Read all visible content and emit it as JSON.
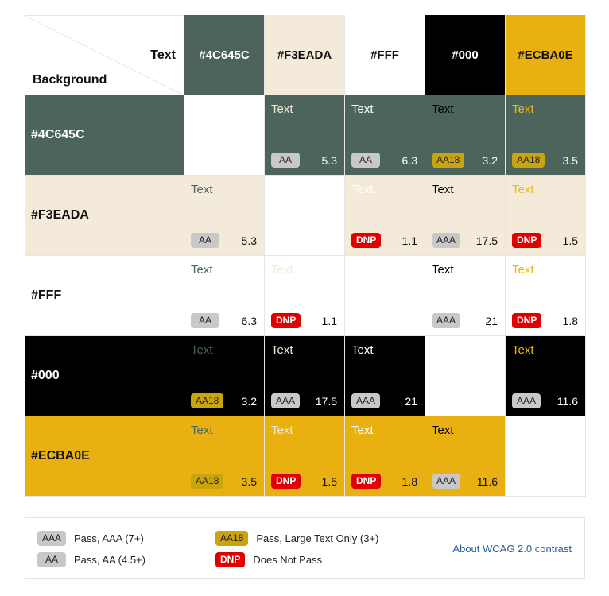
{
  "corner": {
    "text_label": "Text",
    "background_label": "Background"
  },
  "columns": [
    {
      "label": "#4C645C",
      "bg": "#4C645C",
      "fg": "#ffffff"
    },
    {
      "label": "#F3EADA",
      "bg": "#F3EADA",
      "fg": "#111111"
    },
    {
      "label": "#FFF",
      "bg": "#FFFFFF",
      "fg": "#111111"
    },
    {
      "label": "#000",
      "bg": "#000000",
      "fg": "#ffffff"
    },
    {
      "label": "#ECBA0E",
      "bg": "#E8B010",
      "fg": "#111111"
    }
  ],
  "rows": [
    {
      "label": "#4C645C",
      "bg": "#4C645C",
      "fg": "#ffffff",
      "cells": [
        null,
        {
          "text": "Text",
          "color": "#F3EADA",
          "badge": "AA",
          "ratio": "5.3"
        },
        {
          "text": "Text",
          "color": "#FFFFFF",
          "badge": "AA",
          "ratio": "6.3"
        },
        {
          "text": "Text",
          "color": "#000000",
          "badge": "AA18",
          "ratio": "3.2"
        },
        {
          "text": "Text",
          "color": "#ECBA0E",
          "badge": "AA18",
          "ratio": "3.5"
        }
      ]
    },
    {
      "label": "#F3EADA",
      "bg": "#F3EADA",
      "fg": "#111111",
      "cells": [
        {
          "text": "Text",
          "color": "#4C645C",
          "badge": "AA",
          "ratio": "5.3"
        },
        null,
        {
          "text": "Text",
          "color": "#FFFFFF",
          "badge": "DNP",
          "ratio": "1.1"
        },
        {
          "text": "Text",
          "color": "#000000",
          "badge": "AAA",
          "ratio": "17.5"
        },
        {
          "text": "Text",
          "color": "#ECBA0E",
          "badge": "DNP",
          "ratio": "1.5"
        }
      ]
    },
    {
      "label": "#FFF",
      "bg": "#FFFFFF",
      "fg": "#111111",
      "cells": [
        {
          "text": "Text",
          "color": "#4C645C",
          "badge": "AA",
          "ratio": "6.3"
        },
        {
          "text": "Text",
          "color": "#F3EADA",
          "badge": "DNP",
          "ratio": "1.1"
        },
        null,
        {
          "text": "Text",
          "color": "#000000",
          "badge": "AAA",
          "ratio": "21"
        },
        {
          "text": "Text",
          "color": "#ECBA0E",
          "badge": "DNP",
          "ratio": "1.8"
        }
      ]
    },
    {
      "label": "#000",
      "bg": "#000000",
      "fg": "#ffffff",
      "cells": [
        {
          "text": "Text",
          "color": "#4C645C",
          "badge": "AA18",
          "ratio": "3.2"
        },
        {
          "text": "Text",
          "color": "#F3EADA",
          "badge": "AAA",
          "ratio": "17.5"
        },
        {
          "text": "Text",
          "color": "#FFFFFF",
          "badge": "AAA",
          "ratio": "21"
        },
        null,
        {
          "text": "Text",
          "color": "#ECBA0E",
          "badge": "AAA",
          "ratio": "11.6"
        }
      ]
    },
    {
      "label": "#ECBA0E",
      "bg": "#E8B010",
      "fg": "#111111",
      "cells": [
        {
          "text": "Text",
          "color": "#4C645C",
          "badge": "AA18",
          "ratio": "3.5"
        },
        {
          "text": "Text",
          "color": "#F3EADA",
          "badge": "DNP",
          "ratio": "1.5"
        },
        {
          "text": "Text",
          "color": "#FFFFFF",
          "badge": "DNP",
          "ratio": "1.8"
        },
        {
          "text": "Text",
          "color": "#000000",
          "badge": "AAA",
          "ratio": "11.6"
        },
        null
      ]
    }
  ],
  "legend": {
    "aaa": {
      "badge": "AAA",
      "text": "Pass, AAA (7+)"
    },
    "aa": {
      "badge": "AA",
      "text": "Pass, AA (4.5+)"
    },
    "aa18": {
      "badge": "AA18",
      "text": "Pass, Large Text Only (3+)"
    },
    "dnp": {
      "badge": "DNP",
      "text": "Does Not Pass"
    },
    "about_link": "About WCAG 2.0 contrast"
  },
  "colors": {
    "link": "#2a5d9f",
    "dnp": "#e00000",
    "aa18": "#c9a40c",
    "aa": "#c8c8c8"
  }
}
